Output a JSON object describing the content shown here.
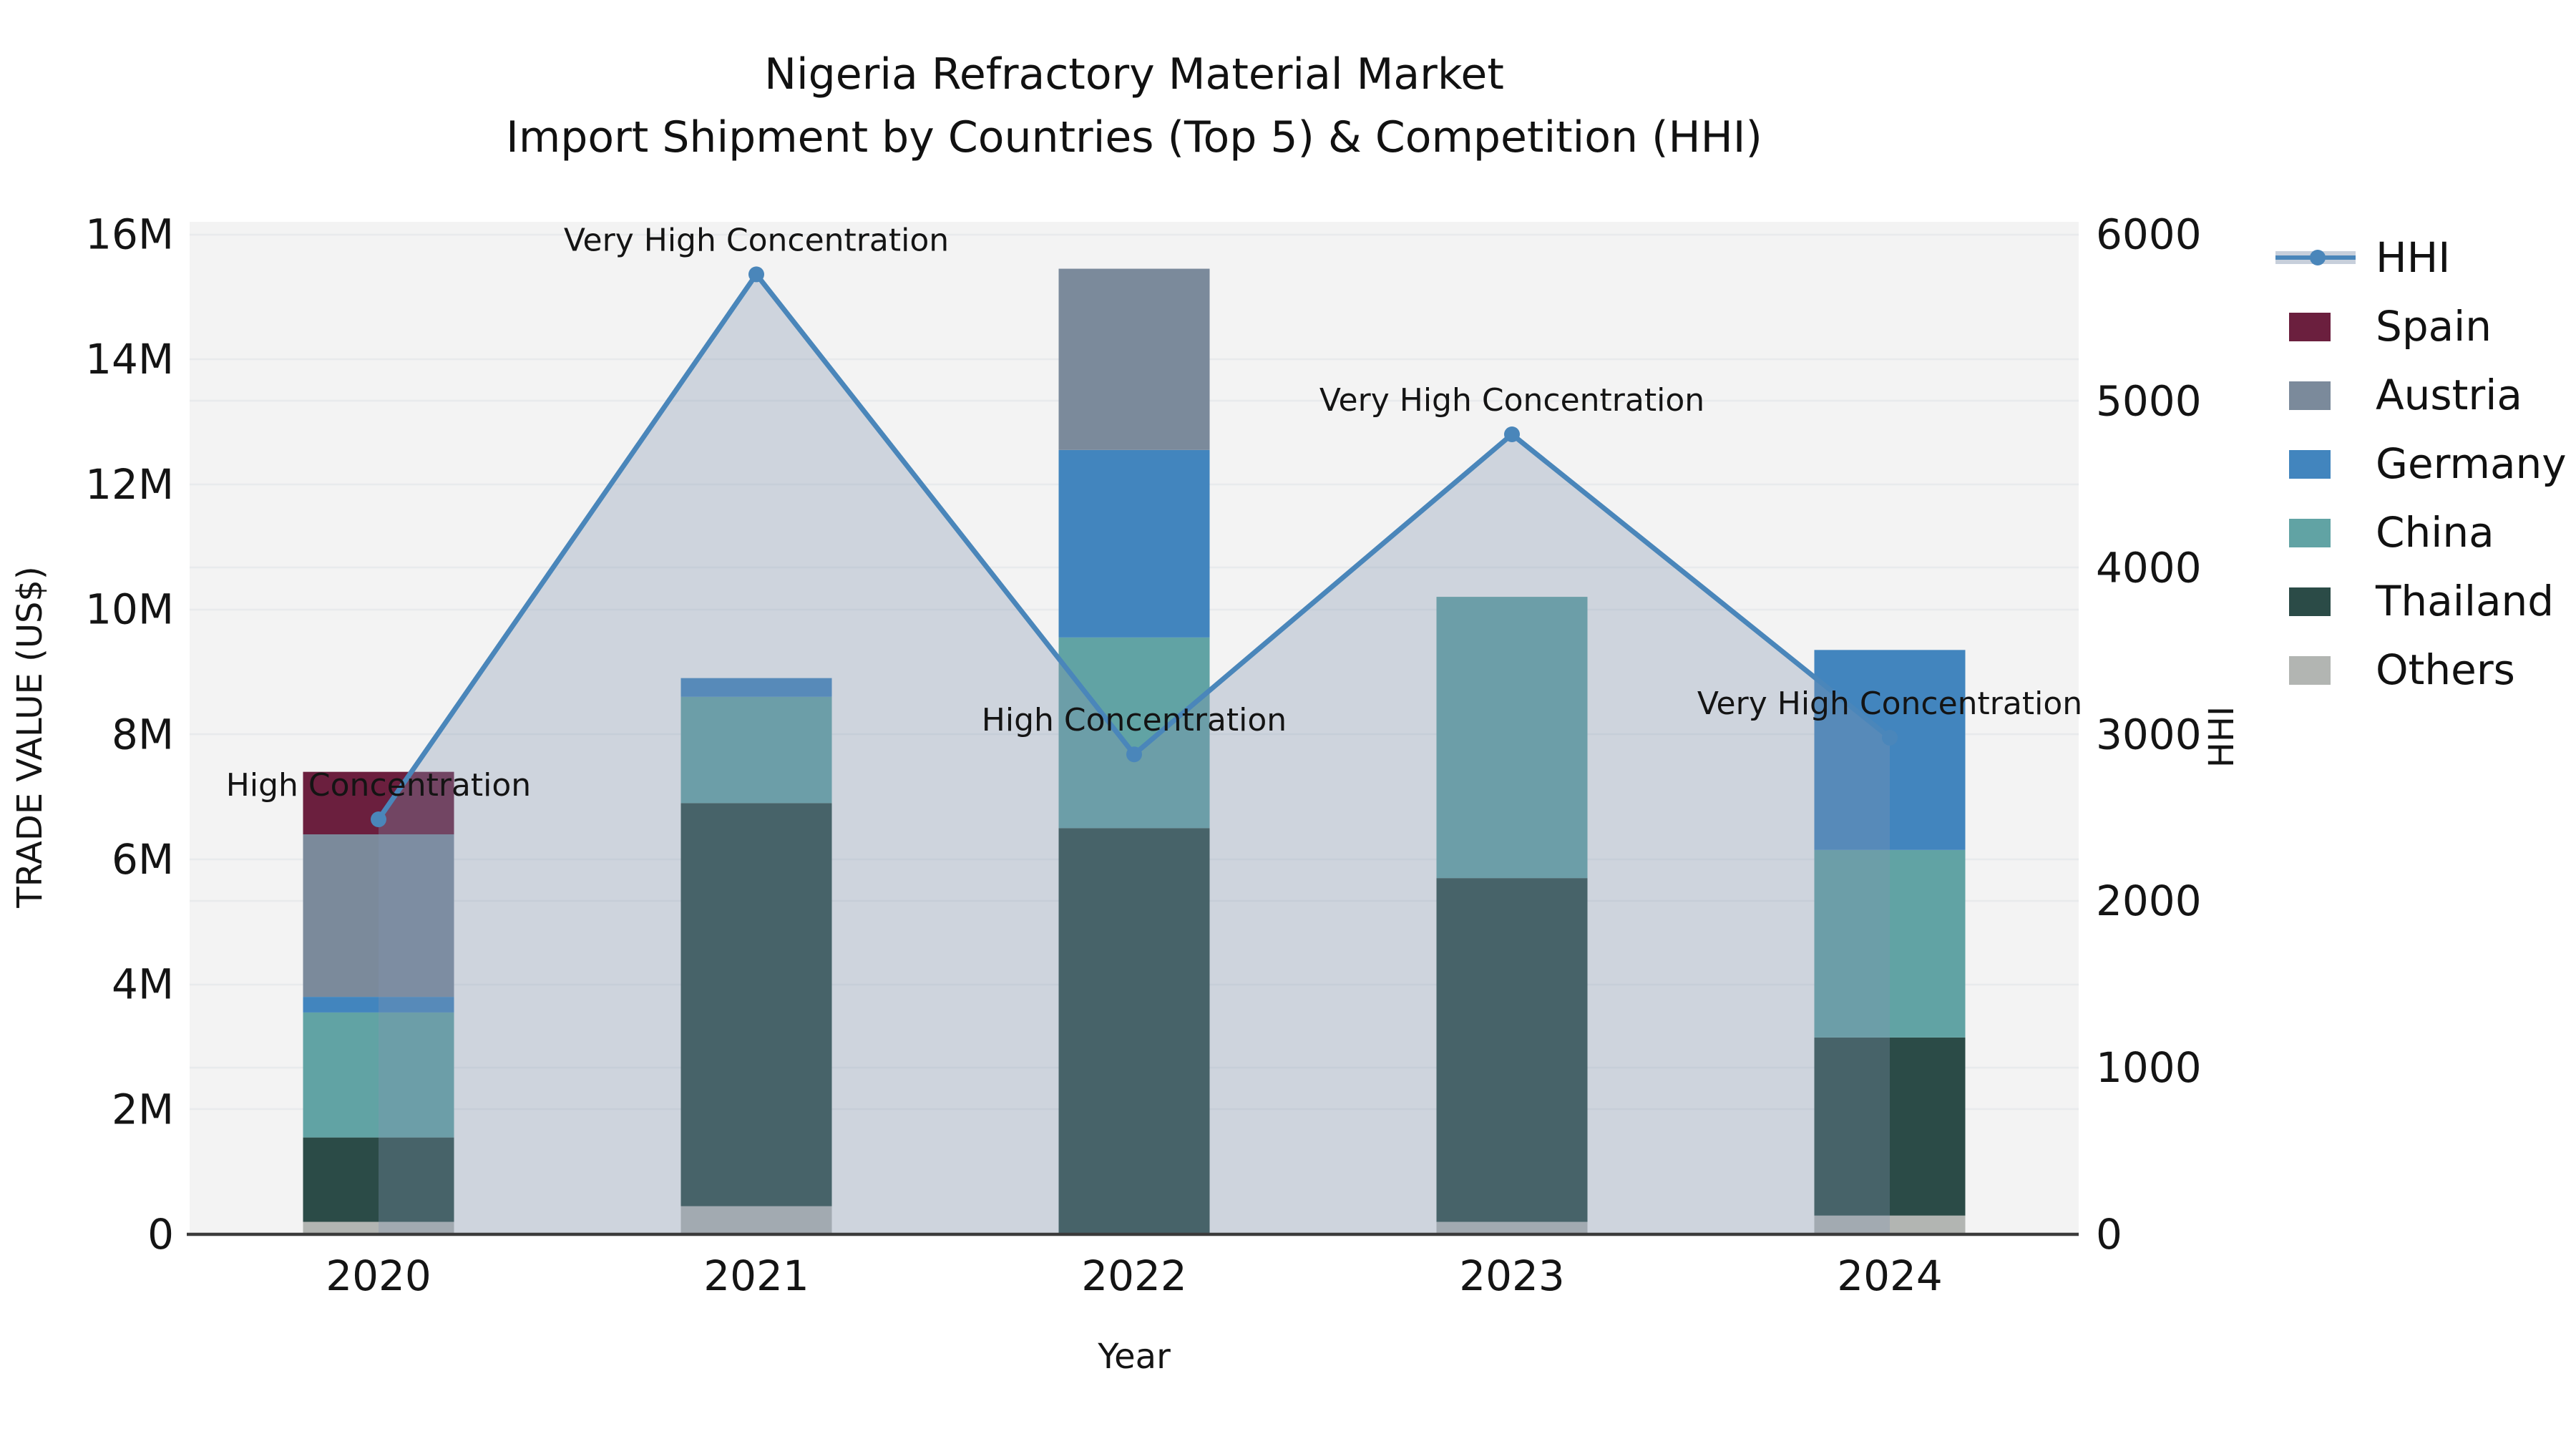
{
  "title": {
    "line1": "Nigeria Refractory Material Market",
    "line2": "Import Shipment by Countries (Top 5) & Competition (HHI)"
  },
  "axes": {
    "x_label": "Year",
    "y_left_label": "TRADE VALUE (US$)",
    "y_right_label": "HHI",
    "y_left_ticks": [
      "0",
      "2M",
      "4M",
      "6M",
      "8M",
      "10M",
      "12M",
      "14M",
      "16M"
    ],
    "y_right_ticks": [
      "0",
      "1000",
      "2000",
      "3000",
      "4000",
      "5000",
      "6000"
    ]
  },
  "legend": {
    "items": [
      {
        "label": "HHI",
        "type": "line",
        "color": "#4a86ba",
        "band_color": "rgba(130,148,176,0.45)"
      },
      {
        "label": "Spain",
        "type": "swatch",
        "color": "#6b1f3e"
      },
      {
        "label": "Austria",
        "type": "swatch",
        "color": "#7b8a9b"
      },
      {
        "label": "Germany",
        "type": "swatch",
        "color": "#4285be"
      },
      {
        "label": "China",
        "type": "swatch",
        "color": "#61a3a4"
      },
      {
        "label": "Thailand",
        "type": "swatch",
        "color": "#2b4b47"
      },
      {
        "label": "Others",
        "type": "swatch",
        "color": "#b2b5b2"
      }
    ]
  },
  "colors": {
    "plot_background": "#f3f3f3",
    "gridline": "#e8eaec",
    "axis_line": "#3b3b3b",
    "hhi_line": "#4a86ba",
    "hhi_area_fill": "rgba(130,148,176,0.33)",
    "text": "#141414"
  },
  "chart_data": {
    "type": "combo (stacked bar + line with area fill)",
    "categories": [
      "2020",
      "2021",
      "2022",
      "2023",
      "2024"
    ],
    "bar_value_unit": "million US$",
    "stack_order_bottom_to_top": [
      "Others",
      "Thailand",
      "China",
      "Germany",
      "Austria",
      "Spain"
    ],
    "series": [
      {
        "name": "Spain",
        "color": "#6b1f3e",
        "values": [
          1.0,
          0,
          0,
          0,
          0
        ]
      },
      {
        "name": "Austria",
        "color": "#7b8a9b",
        "values": [
          2.6,
          0,
          2.9,
          0,
          0
        ]
      },
      {
        "name": "Germany",
        "color": "#4285be",
        "values": [
          0.25,
          0.3,
          3.0,
          0,
          3.2
        ]
      },
      {
        "name": "China",
        "color": "#61a3a4",
        "values": [
          2.0,
          1.7,
          3.05,
          4.5,
          3.0
        ]
      },
      {
        "name": "Thailand",
        "color": "#2b4b47",
        "values": [
          1.35,
          6.45,
          6.5,
          5.5,
          2.85
        ]
      },
      {
        "name": "Others",
        "color": "#b2b5b2",
        "values": [
          0.2,
          0.45,
          0,
          0.2,
          0.3
        ]
      }
    ],
    "bar_totals_million": [
      7.4,
      8.9,
      15.45,
      10.2,
      9.35
    ],
    "line": {
      "name": "HHI",
      "values": [
        2490,
        5760,
        2880,
        4800,
        2980
      ]
    },
    "annotations": [
      "High Concentration",
      "Very High Concentration",
      "High Concentration",
      "Very High Concentration",
      "Very High Concentration"
    ],
    "ylim_left_million": [
      0,
      16
    ],
    "ylim_right": [
      0,
      6000
    ],
    "y_left_tick_step_million": 2,
    "y_right_tick_step": 1000,
    "grid": true,
    "legend_position": "outside right, top"
  }
}
